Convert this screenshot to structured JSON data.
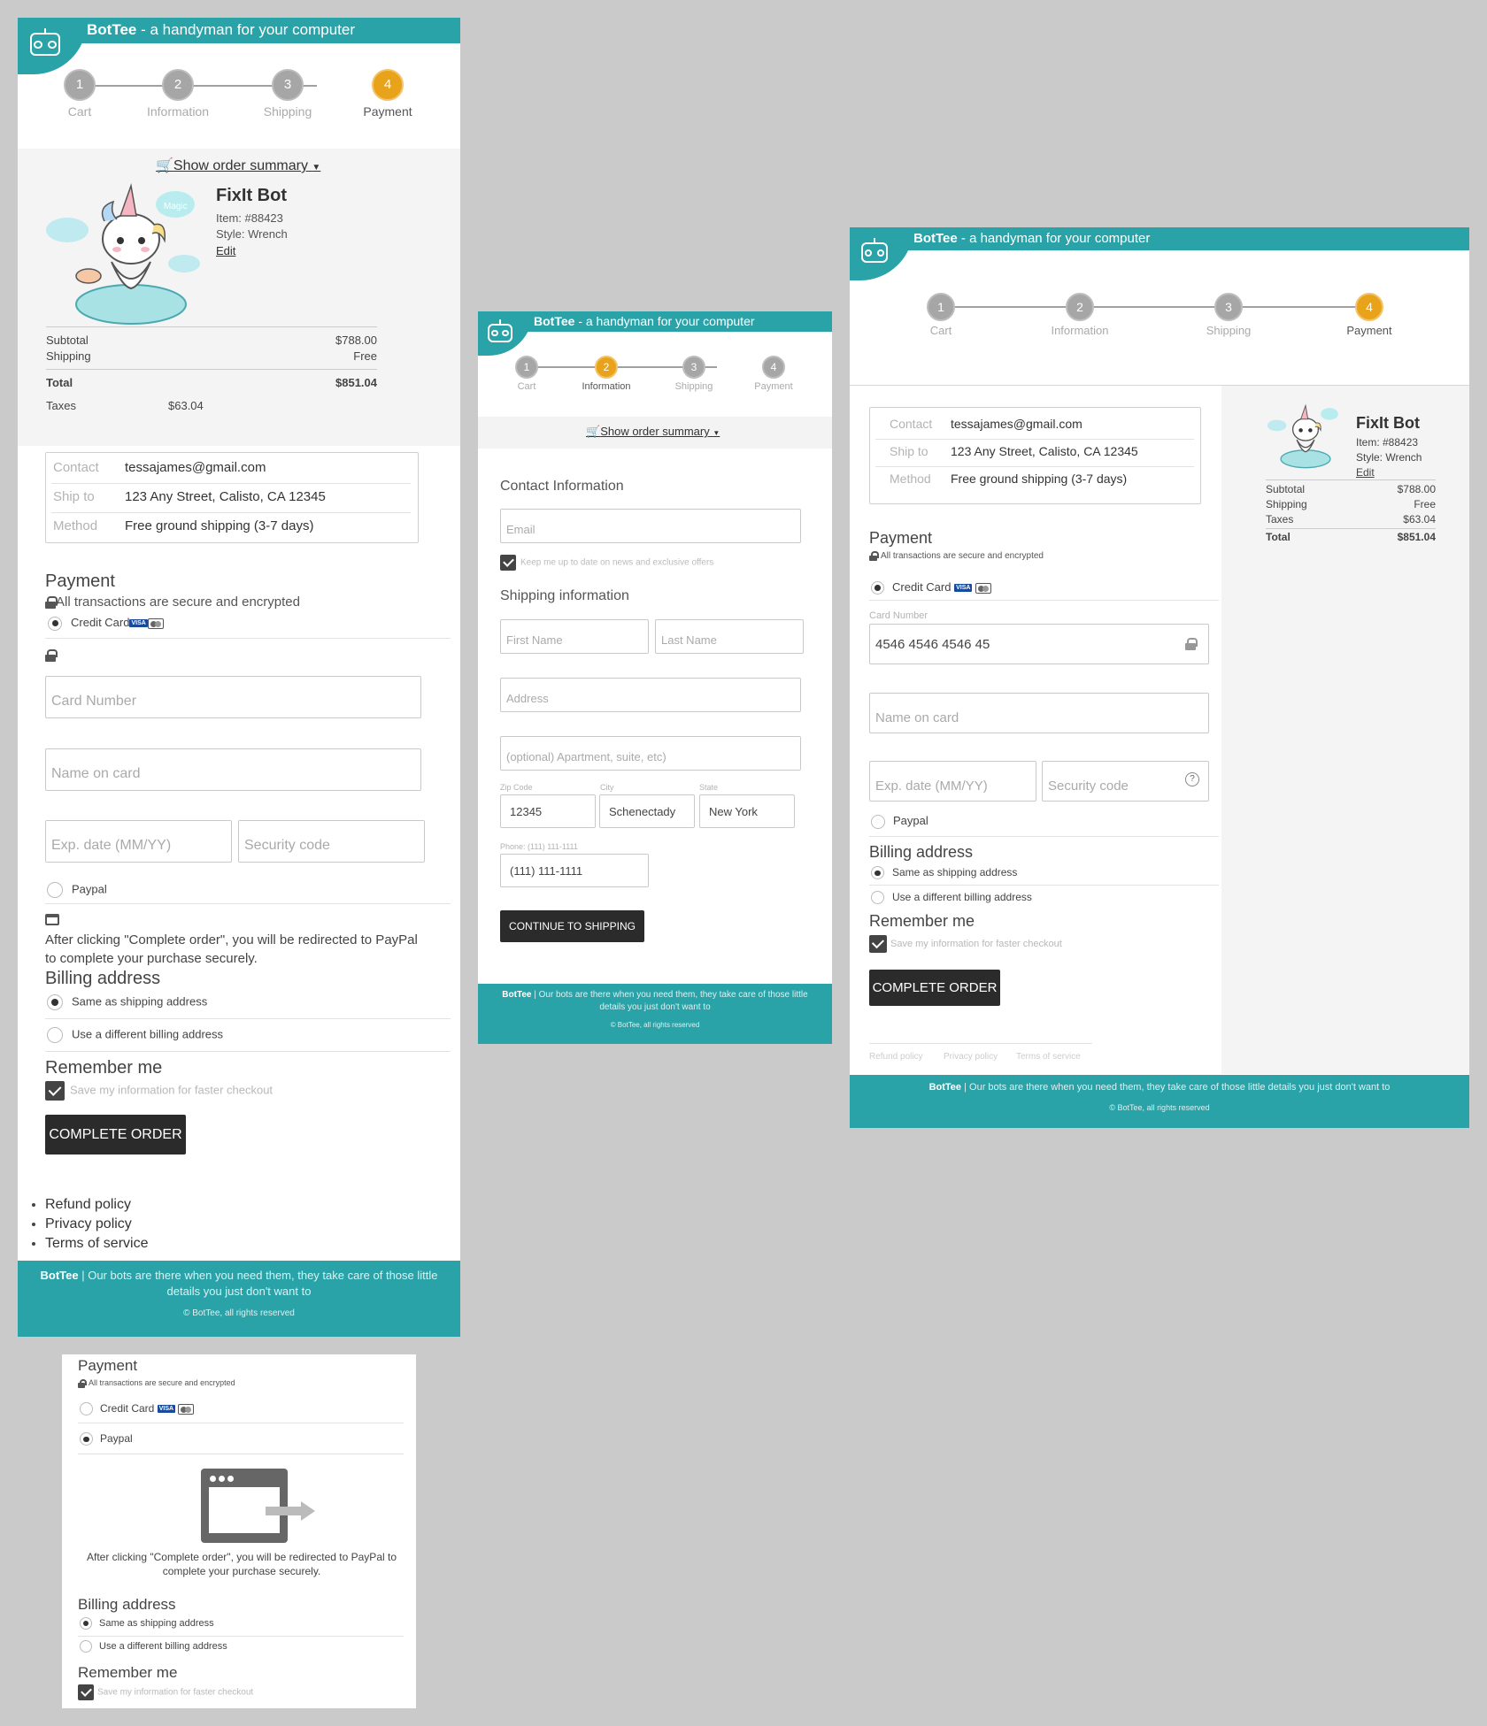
{
  "brand": {
    "name": "BotTee",
    "tagline": "- a handyman for your computer",
    "footer_text": "| Our bots are there when you need them, they take care of those little details you just don't want to",
    "copyright": "© BotTee, all rights reserved",
    "teal": "#29a3a8",
    "accent_orange": "#e9a31b",
    "dark_button": "#2b2b2b"
  },
  "steps": [
    {
      "num": "1",
      "label": "Cart"
    },
    {
      "num": "2",
      "label": "Information"
    },
    {
      "num": "3",
      "label": "Shipping"
    },
    {
      "num": "4",
      "label": "Payment"
    }
  ],
  "order": {
    "summary_toggle": "Show order summary",
    "product_name": "FixIt Bot",
    "item": "Item: #88423",
    "style": "Style: Wrench",
    "edit": "Edit",
    "bubble_text": "Magic",
    "subtotal_label": "Subtotal",
    "subtotal": "$788.00",
    "shipping_label": "Shipping",
    "shipping": "Free",
    "taxes_label": "Taxes",
    "taxes": "$63.04",
    "total_label": "Total",
    "total": "$851.04"
  },
  "review": {
    "contact_label": "Contact",
    "contact": "tessajames@gmail.com",
    "shipto_label": "Ship to",
    "shipto": "123 Any Street, Calisto, CA 12345",
    "method_label": "Method",
    "method": "Free ground shipping (3-7 days)"
  },
  "payment": {
    "title": "Payment",
    "secure": "All transactions are secure and encrypted",
    "credit_card": "Credit Card",
    "visa": "VISA",
    "card_number_ph": "Card Number",
    "card_number_label": "Card Number",
    "card_number_value": "4546 4546 4546 45",
    "name_ph": "Name on card",
    "exp_ph": "Exp. date (MM/YY)",
    "cvc_ph": "Security code",
    "help": "?",
    "paypal": "Paypal",
    "redirect": "After clicking \"Complete order\", you will be redirected to PayPal to complete your purchase securely.",
    "billing_title": "Billing address",
    "same_address": "Same as shipping address",
    "different_address": "Use a different billing address",
    "remember_title": "Remember me",
    "save_info": "Save my information for faster checkout",
    "complete": "COMPLETE ORDER"
  },
  "policies": [
    "Refund policy",
    "Privacy policy",
    "Terms of service"
  ],
  "info_form": {
    "contact_title": "Contact Information",
    "email_ph": "Email",
    "news": "Keep me up to date on news and exclusive offers",
    "shipping_title": "Shipping information",
    "first_ph": "First Name",
    "last_ph": "Last Name",
    "address_ph": "Address",
    "apt_ph": "(optional) Apartment, suite, etc)",
    "zip_label": "Zip Code",
    "zip": "12345",
    "city_label": "City",
    "city": "Schenectady",
    "state_label": "State",
    "state": "New York",
    "phone_label": "Phone: (111) 111-1111",
    "phone": "(111) 111-1111",
    "continue": "CONTINUE TO SHIPPING"
  }
}
